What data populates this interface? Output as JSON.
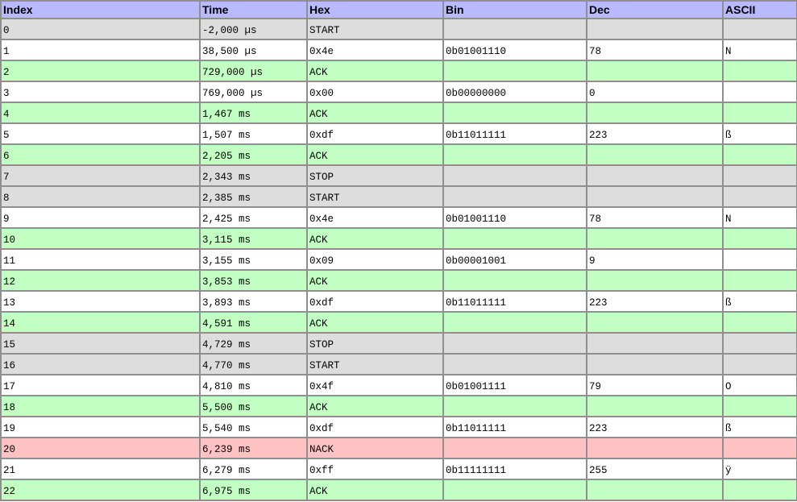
{
  "columns": [
    "Index",
    "Time",
    "Hex",
    "Bin",
    "Dec",
    "ASCII"
  ],
  "row_colors": {
    "start_stop": "#dddddd",
    "data": "#ffffff",
    "ack": "#c2ffc2",
    "nack": "#ffc2c2",
    "header": "#b9b9ff"
  },
  "rows": [
    {
      "kind": "start",
      "index": "0",
      "time": "-2,000 µs",
      "hex": "START",
      "bin": "",
      "dec": "",
      "ascii": ""
    },
    {
      "kind": "data",
      "index": "1",
      "time": "38,500 µs",
      "hex": "0x4e",
      "bin": "0b01001110",
      "dec": "78",
      "ascii": "N"
    },
    {
      "kind": "ack",
      "index": "2",
      "time": "729,000 µs",
      "hex": "ACK",
      "bin": "",
      "dec": "",
      "ascii": ""
    },
    {
      "kind": "data",
      "index": "3",
      "time": "769,000 µs",
      "hex": "0x00",
      "bin": "0b00000000",
      "dec": "0",
      "ascii": ""
    },
    {
      "kind": "ack",
      "index": "4",
      "time": "1,467 ms",
      "hex": "ACK",
      "bin": "",
      "dec": "",
      "ascii": ""
    },
    {
      "kind": "data",
      "index": "5",
      "time": "1,507 ms",
      "hex": "0xdf",
      "bin": "0b11011111",
      "dec": "223",
      "ascii": "ß"
    },
    {
      "kind": "ack",
      "index": "6",
      "time": "2,205 ms",
      "hex": "ACK",
      "bin": "",
      "dec": "",
      "ascii": ""
    },
    {
      "kind": "stop",
      "index": "7",
      "time": "2,343 ms",
      "hex": "STOP",
      "bin": "",
      "dec": "",
      "ascii": ""
    },
    {
      "kind": "start",
      "index": "8",
      "time": "2,385 ms",
      "hex": "START",
      "bin": "",
      "dec": "",
      "ascii": ""
    },
    {
      "kind": "data",
      "index": "9",
      "time": "2,425 ms",
      "hex": "0x4e",
      "bin": "0b01001110",
      "dec": "78",
      "ascii": "N"
    },
    {
      "kind": "ack",
      "index": "10",
      "time": "3,115 ms",
      "hex": "ACK",
      "bin": "",
      "dec": "",
      "ascii": ""
    },
    {
      "kind": "data",
      "index": "11",
      "time": "3,155 ms",
      "hex": "0x09",
      "bin": "0b00001001",
      "dec": "9",
      "ascii": ""
    },
    {
      "kind": "ack",
      "index": "12",
      "time": "3,853 ms",
      "hex": "ACK",
      "bin": "",
      "dec": "",
      "ascii": ""
    },
    {
      "kind": "data",
      "index": "13",
      "time": "3,893 ms",
      "hex": "0xdf",
      "bin": "0b11011111",
      "dec": "223",
      "ascii": "ß"
    },
    {
      "kind": "ack",
      "index": "14",
      "time": "4,591 ms",
      "hex": "ACK",
      "bin": "",
      "dec": "",
      "ascii": ""
    },
    {
      "kind": "stop",
      "index": "15",
      "time": "4,729 ms",
      "hex": "STOP",
      "bin": "",
      "dec": "",
      "ascii": ""
    },
    {
      "kind": "start",
      "index": "16",
      "time": "4,770 ms",
      "hex": "START",
      "bin": "",
      "dec": "",
      "ascii": ""
    },
    {
      "kind": "data",
      "index": "17",
      "time": "4,810 ms",
      "hex": "0x4f",
      "bin": "0b01001111",
      "dec": "79",
      "ascii": "O"
    },
    {
      "kind": "ack",
      "index": "18",
      "time": "5,500 ms",
      "hex": "ACK",
      "bin": "",
      "dec": "",
      "ascii": ""
    },
    {
      "kind": "data",
      "index": "19",
      "time": "5,540 ms",
      "hex": "0xdf",
      "bin": "0b11011111",
      "dec": "223",
      "ascii": "ß"
    },
    {
      "kind": "nack",
      "index": "20",
      "time": "6,239 ms",
      "hex": "NACK",
      "bin": "",
      "dec": "",
      "ascii": ""
    },
    {
      "kind": "data",
      "index": "21",
      "time": "6,279 ms",
      "hex": "0xff",
      "bin": "0b11111111",
      "dec": "255",
      "ascii": "ÿ"
    },
    {
      "kind": "ack",
      "index": "22",
      "time": "6,975 ms",
      "hex": "ACK",
      "bin": "",
      "dec": "",
      "ascii": ""
    }
  ]
}
